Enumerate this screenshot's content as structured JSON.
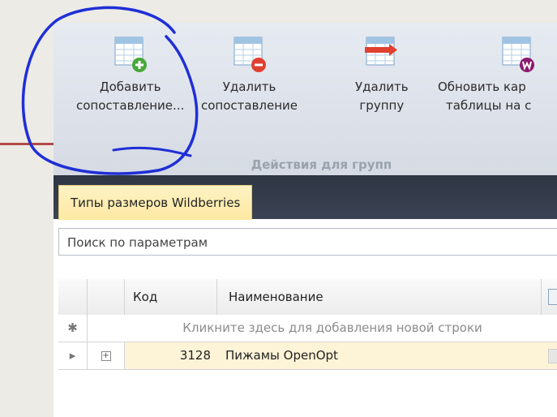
{
  "ribbon": {
    "buttons": [
      {
        "line1": "Добавить",
        "line2": "сопоставление..."
      },
      {
        "line1": "Удалить",
        "line2": "сопоставление"
      },
      {
        "line1": "Удалить",
        "line2": "группу"
      },
      {
        "line1": "Обновить кар",
        "line2": "таблицы на с"
      }
    ],
    "group_label": "Действия для групп"
  },
  "tab": {
    "label": "Типы размеров Wildberries"
  },
  "search": {
    "placeholder": "Поиск по параметрам"
  },
  "grid": {
    "columns": {
      "code": "Код",
      "name": "Наименование"
    },
    "new_row_hint": "Кликните здесь для добавления новой строки",
    "rows": [
      {
        "code": "3128",
        "name": "Пижамы OpenOpt"
      }
    ]
  },
  "colors": {
    "annotation": "#1f2fd6",
    "tab_active": "#fde8a2",
    "row_highlight": "#fdf3d6"
  }
}
